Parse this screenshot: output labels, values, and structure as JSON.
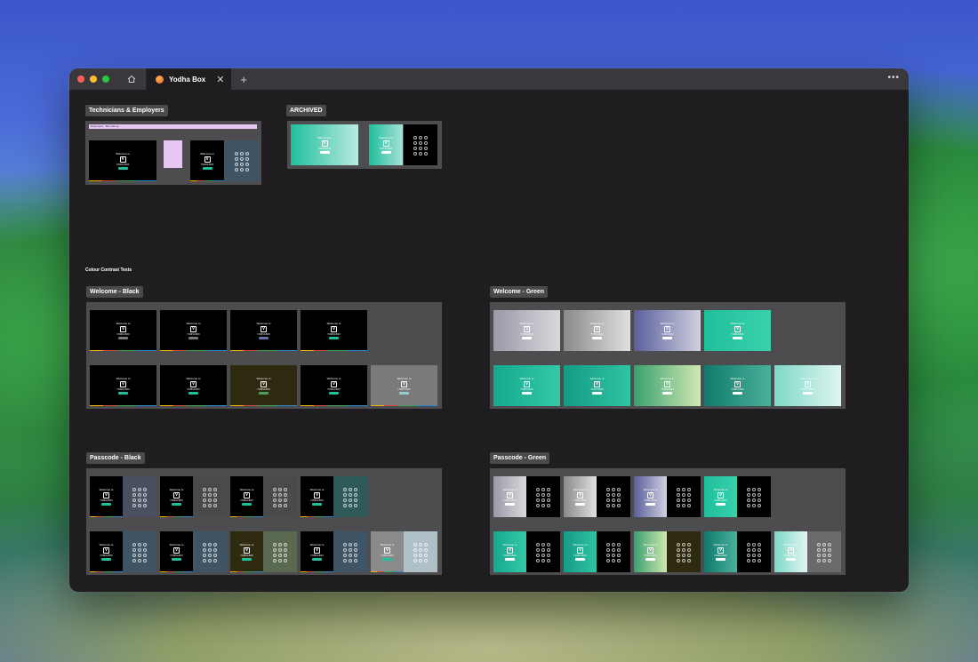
{
  "window": {
    "tab_title": "Yodha Box",
    "more_label": "•••",
    "new_tab_label": "+",
    "close_label": "✕"
  },
  "icons": [
    "home-icon",
    "close-icon",
    "plus-icon",
    "more-icon",
    "app-icon"
  ],
  "frames": {
    "technicians": "Technicians & Employers",
    "archived": "ARCHIVED",
    "section_title": "Colour Contrast Tests",
    "welcome_black": "Welcome - Black",
    "welcome_green": "Welcome - Green",
    "passcode_black": "Passcode - Black",
    "passcode_green": "Passcode - Green"
  },
  "thumbnail_text": {
    "welcome": "Welcome to",
    "logo": "V",
    "brand": "YODHA BOX",
    "employers_bar": "Employers - Box Set-up"
  },
  "colors": {
    "accent_green": "#1fbf9c",
    "frame_bg": "#4d4c4f",
    "canvas_bg": "#1f1d20"
  }
}
